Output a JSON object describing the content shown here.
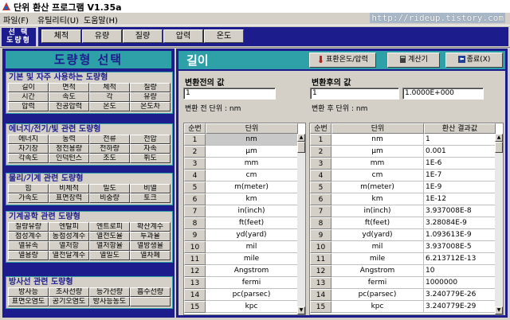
{
  "window": {
    "title": "단위 환산 프로그램 V1.35a",
    "url": "http://rideup.tistory.com"
  },
  "menu": [
    "파일(F)",
    "유틸리티(U)",
    "도움말(H)"
  ],
  "toolbar": {
    "label_line1": "선 택",
    "label_line2": "도량형",
    "tabs": [
      "체적",
      "유량",
      "질량",
      "압력",
      "온도"
    ]
  },
  "left": {
    "title": "도량형 선택",
    "groups": [
      {
        "title": "기본 및 자주 사용하는 도량형",
        "items": [
          "길이",
          "면적",
          "체적",
          "질량",
          "시간",
          "속도",
          "각",
          "유량",
          "압력",
          "진공압력",
          "온도",
          "온도차"
        ]
      },
      {
        "title": "에너지/전기/빛 관련 도량형",
        "items": [
          "에너지",
          "동력",
          "전류",
          "전압",
          "자기장",
          "정전용량",
          "전하량",
          "자속",
          "각속도",
          "인덕턴스",
          "조도",
          "휘도"
        ]
      },
      {
        "title": "물리/기계 관련 도량형",
        "items": [
          "힘",
          "비체적",
          "밀도",
          "비열",
          "가속도",
          "표면장력",
          "비중량",
          "토크"
        ]
      },
      {
        "title": "기계공학 관련 도량형",
        "items": [
          "질량유량",
          "엔탈피",
          "엔트로피",
          "확산계수",
          "점성계수",
          "동점성계수",
          "열전도율",
          "투과율",
          "열유속",
          "열저항",
          "열저항율",
          "열방생율",
          "열용량",
          "열전달계수",
          "열밀도",
          "열차폐"
        ]
      },
      {
        "title": "방사선 관련 도량형",
        "items": [
          "방사능",
          "조사선량",
          "등가선량",
          "흡수선량",
          "표면오염도",
          "공기오염도",
          "방사능농도",
          ""
        ]
      }
    ]
  },
  "right": {
    "title": "길이",
    "buttons": {
      "temp": "표환온도/압력",
      "calc": "계산기",
      "exit": "종료(X)"
    },
    "before_label": "변환전의 값",
    "before_value": "1",
    "before_unit_label": "변환 전 단위 : nm",
    "after_label": "변환후의 값",
    "after_value": "1",
    "after_value2": "1.0000E+000",
    "after_unit_label": "변환 후 단위 : nm",
    "table_left": {
      "headers": [
        "순번",
        "단위"
      ],
      "rows": [
        [
          "1",
          "nm"
        ],
        [
          "2",
          "μm"
        ],
        [
          "3",
          "mm"
        ],
        [
          "4",
          "cm"
        ],
        [
          "5",
          "m(meter)"
        ],
        [
          "6",
          "km"
        ],
        [
          "7",
          "in(inch)"
        ],
        [
          "8",
          "ft(feet)"
        ],
        [
          "9",
          "yd(yard)"
        ],
        [
          "10",
          "mil"
        ],
        [
          "11",
          "mile"
        ],
        [
          "12",
          "Angstrom"
        ],
        [
          "13",
          "fermi"
        ],
        [
          "14",
          "pc(parsec)"
        ],
        [
          "15",
          "kpc"
        ]
      ]
    },
    "table_right": {
      "headers": [
        "순번",
        "단위",
        "환산 결과값"
      ],
      "rows": [
        [
          "1",
          "nm",
          "1"
        ],
        [
          "2",
          "μm",
          "0.001"
        ],
        [
          "3",
          "mm",
          "1E-6"
        ],
        [
          "4",
          "cm",
          "1E-7"
        ],
        [
          "5",
          "m(meter)",
          "1E-9"
        ],
        [
          "6",
          "km",
          "1E-12"
        ],
        [
          "7",
          "in(inch)",
          "3.937008E-8"
        ],
        [
          "8",
          "ft(feet)",
          "3.28084E-9"
        ],
        [
          "9",
          "yd(yard)",
          "1.093613E-9"
        ],
        [
          "10",
          "mil",
          "3.937008E-5"
        ],
        [
          "11",
          "mile",
          "6.213712E-13"
        ],
        [
          "12",
          "Angstrom",
          "10"
        ],
        [
          "13",
          "fermi",
          "1000000"
        ],
        [
          "14",
          "pc(parsec)",
          "3.240779E-26"
        ],
        [
          "15",
          "kpc",
          "3.240779E-29"
        ]
      ]
    }
  },
  "colors": {
    "panel": "#1c1c8c",
    "teal": "#2ea0a8",
    "face": "#d4d0c8"
  }
}
